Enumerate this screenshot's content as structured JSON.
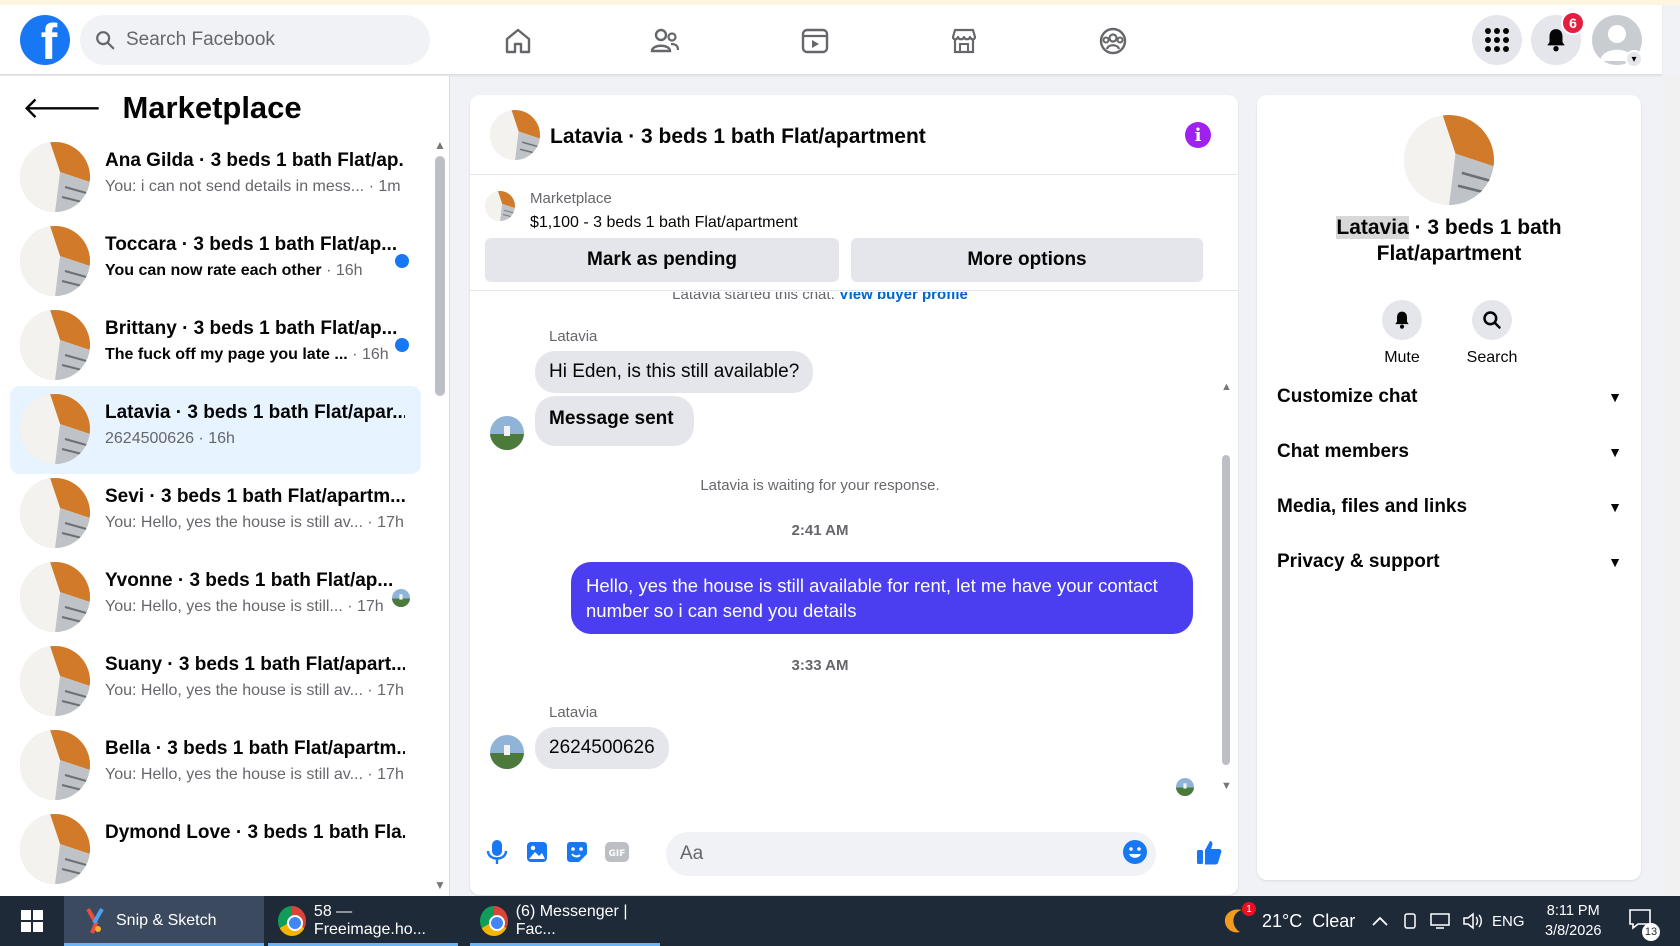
{
  "topbar": {
    "logo_letter": "f",
    "search_placeholder": "Search Facebook",
    "notification_count": "6"
  },
  "sidebar": {
    "title": "Marketplace",
    "conversations": [
      {
        "name": "Ana Gilda · 3 beds 1 bath Flat/ap...",
        "preview": "You: i can not send details in mess...",
        "time": " · 1m",
        "unread": false,
        "active": false
      },
      {
        "name": "Toccara · 3 beds 1 bath Flat/ap...",
        "preview": "You can now rate each other",
        "time": " · 16h",
        "unread": true,
        "active": false
      },
      {
        "name": "Brittany · 3 beds 1 bath Flat/ap...",
        "preview": "The fuck off my page you late ...",
        "time": " · 16h",
        "unread": true,
        "active": false
      },
      {
        "name": "Latavia · 3 beds 1 bath Flat/apar...",
        "preview": "2624500626",
        "time": " · 16h",
        "unread": false,
        "active": true
      },
      {
        "name": "Sevi · 3 beds 1 bath Flat/apartm...",
        "preview": "You: Hello, yes the house is still av...",
        "time": " · 17h",
        "unread": false,
        "active": false
      },
      {
        "name": "Yvonne · 3 beds 1 bath Flat/ap...",
        "preview": "You: Hello, yes the house is still...",
        "time": " · 17h",
        "unread": false,
        "active": false
      },
      {
        "name": "Suany · 3 beds 1 bath Flat/apart...",
        "preview": "You: Hello, yes the house is still av...",
        "time": " · 17h",
        "unread": false,
        "active": false
      },
      {
        "name": "Bella · 3 beds 1 bath Flat/apartm...",
        "preview": "You: Hello, yes the house is still av...",
        "time": " · 17h",
        "unread": false,
        "active": false
      },
      {
        "name": "Dymond Love · 3 beds 1 bath Fla...",
        "preview": "",
        "time": "",
        "unread": false,
        "active": false
      }
    ]
  },
  "chat": {
    "title": "Latavia · 3 beds 1 bath Flat/apartment",
    "listing_source": "Marketplace",
    "listing_price": "$1,100 - 3 beds 1 bath Flat/apartment",
    "btn_pending": "Mark as pending",
    "btn_more": "More options",
    "started_text": "Latavia started this chat.",
    "buyer_link": "View buyer profile",
    "sender1": "Latavia",
    "msg1": "Hi Eden, is this still available?",
    "msg2": "Message sent",
    "waiting": "Latavia is waiting for your response.",
    "time1": "2:41 AM",
    "msg_out": "Hello, yes the house is still available for rent, let me have your contact number so i can send you details",
    "time2": "3:33 AM",
    "sender2": "Latavia",
    "msg3": "2624500626",
    "composer_placeholder": "Aa"
  },
  "right": {
    "name_highlight": "Latavia",
    "title_rest": " · 3 beds 1 bath",
    "title_line2": "Flat/apartment",
    "action_mute": "Mute",
    "action_search": "Search",
    "sections": [
      "Customize chat",
      "Chat members",
      "Media, files and links",
      "Privacy & support"
    ]
  },
  "taskbar": {
    "app1": "Snip & Sketch",
    "app2": "58 — Freeimage.ho...",
    "app3": "(6) Messenger | Fac...",
    "weather": "21°C  Clear",
    "lang": "ENG",
    "time": "8:11 PM",
    "date": "3/8/2026",
    "notif_count": "13",
    "weather_badge": "1"
  },
  "colors": {
    "brand": "#1877f2",
    "outgoing_bubble": "#4a3ef0",
    "active_row": "#e7f3ff"
  }
}
